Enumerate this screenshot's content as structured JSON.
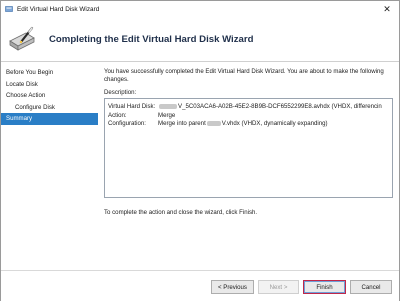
{
  "window": {
    "title": "Edit Virtual Hard Disk Wizard"
  },
  "header": {
    "title": "Completing the Edit Virtual Hard Disk Wizard"
  },
  "sidebar": {
    "items": [
      {
        "label": "Before You Begin"
      },
      {
        "label": "Locate Disk"
      },
      {
        "label": "Choose Action"
      },
      {
        "label": "Configure Disk"
      },
      {
        "label": "Summary"
      }
    ]
  },
  "content": {
    "intro": "You have successfully completed the Edit Virtual Hard Disk Wizard. You are about to make the following changes.",
    "description_label": "Description:",
    "rows": [
      {
        "key": "Virtual Hard Disk:",
        "value_suffix": "V_5C03ACA6-A02B-45E2-8B9B-DCF6552299E8.avhdx (VHDX, differencin"
      },
      {
        "key": "Action:",
        "value": "Merge"
      },
      {
        "key": "Configuration:",
        "value_prefix": "Merge into parent",
        "value_suffix": "V.vhdx (VHDX, dynamically expanding)"
      }
    ],
    "finish_hint": "To complete the action and close the wizard, click Finish."
  },
  "buttons": {
    "previous": "< Previous",
    "next": "Next >",
    "finish": "Finish",
    "cancel": "Cancel"
  }
}
